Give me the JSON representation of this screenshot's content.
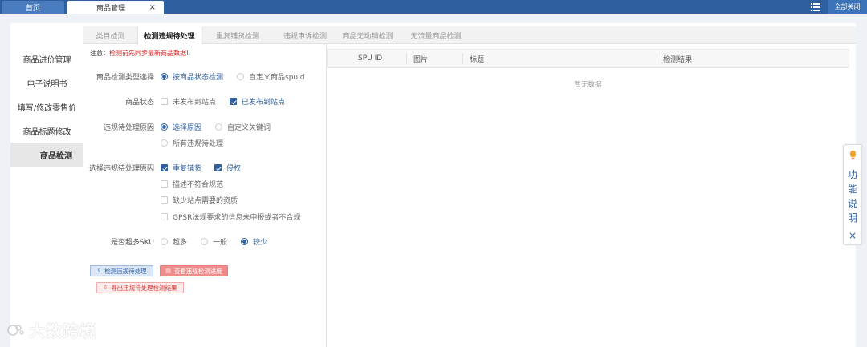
{
  "topbar": {
    "home_tab": "首页",
    "active_tab": "商品管理",
    "active_tab_close": "×",
    "close_all": "全部关闭"
  },
  "sidebar": {
    "items": [
      {
        "label": "商品进价管理"
      },
      {
        "label": "电子说明书"
      },
      {
        "label": "填写/修改零售价"
      },
      {
        "label": "商品标题修改"
      },
      {
        "label": "商品检测",
        "active": true
      }
    ]
  },
  "subtabs": [
    {
      "label": "类目检测"
    },
    {
      "label": "检测违规待处理",
      "active": true
    },
    {
      "label": "重复铺货检测"
    },
    {
      "label": "违规申诉检测"
    },
    {
      "label": "商品无动销检测"
    },
    {
      "label": "无流量商品检测"
    }
  ],
  "notice": {
    "prefix": "注意：",
    "text": "检测前先同步最新商品数据!"
  },
  "form": {
    "check_type": {
      "label": "商品检测类型选择",
      "options": [
        {
          "label": "按商品状态检测",
          "checked": true
        },
        {
          "label": "自定义商品spuId",
          "checked": false
        }
      ]
    },
    "product_status": {
      "label": "商品状态",
      "options": [
        {
          "label": "未发布到站点",
          "checked": false
        },
        {
          "label": "已发布到站点",
          "checked": true
        }
      ]
    },
    "violation_reason": {
      "label": "违规待处理原因",
      "options": [
        {
          "label": "选择原因",
          "checked": true
        },
        {
          "label": "自定义关键词",
          "checked": false
        },
        {
          "label": "所有违规待处理",
          "checked": false
        }
      ]
    },
    "select_reason": {
      "label": "选择违规待处理原因",
      "options": [
        {
          "label": "重复铺货",
          "checked": true
        },
        {
          "label": "侵权",
          "checked": true
        },
        {
          "label": "描述不符合规范",
          "checked": false
        },
        {
          "label": "缺少站点需要的资质",
          "checked": false
        },
        {
          "label": "GPSR法规要求的信息未申报或者不合规",
          "checked": false
        }
      ]
    },
    "many_sku": {
      "label": "是否超多SKU",
      "options": [
        {
          "label": "超多",
          "checked": false
        },
        {
          "label": "一般",
          "checked": false
        },
        {
          "label": "较少",
          "checked": true
        }
      ]
    }
  },
  "buttons": {
    "detect": "检测违规待处理",
    "view_progress": "查看违规检测进度",
    "export": "导出违规待处理检测结果"
  },
  "table": {
    "columns": [
      "SPU ID",
      "图片",
      "标题",
      "检测结果"
    ],
    "empty_text": "暂无数据"
  },
  "float_help": {
    "chars": [
      "功",
      "能",
      "说",
      "明"
    ],
    "close": "×"
  },
  "watermark": {
    "text": "大数跨境"
  },
  "colors": {
    "primary": "#2f5f9f",
    "danger": "#e02020",
    "topbar": "#2f5f9f"
  }
}
